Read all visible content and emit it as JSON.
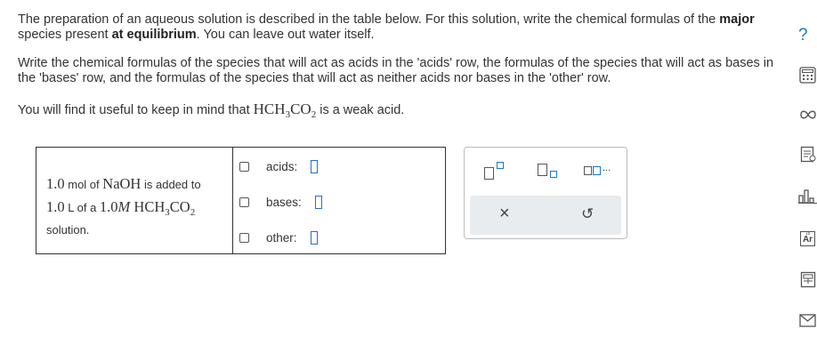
{
  "intro": {
    "p1_a": "The preparation of an aqueous solution is described in the table below. For this solution, write the chemical formulas of the",
    "p1_major": "major",
    "p1_b": "species present",
    "p1_eq": "at equilibrium",
    "p1_c": ". You can leave out water itself.",
    "p2": "Write the chemical formulas of the species that will act as acids in the 'acids' row, the formulas of the species that will act as bases in the 'bases' row, and the formulas of the species that will act as neither acids nor bases in the 'other' row.",
    "p3_a": "You will find it useful to keep in mind that",
    "p3_formula_main": "HCH",
    "p3_sub1": "3",
    "p3_formula_co": "CO",
    "p3_sub2": "2",
    "p3_b": "is a weak acid."
  },
  "table": {
    "line1_amt": "1.0",
    "line1_unit": "mol of",
    "line1_species": "NaOH",
    "line1_rest": "is added to",
    "line2_amt": "1.0",
    "line2_unit": "L of a",
    "line2_conc": "1.0",
    "line2_M": "M",
    "line2_formula": "HCH",
    "line2_sub1": "3",
    "line2_co": "CO",
    "line2_sub2": "2",
    "line3": "solution.",
    "rows": [
      {
        "label": "acids:"
      },
      {
        "label": "bases:"
      },
      {
        "label": "other:"
      }
    ]
  },
  "toolbox": {
    "ellipsis": "...",
    "clear_symbol": "×",
    "undo_symbol": "↺"
  },
  "sidebar": {
    "help": "?",
    "periodic_label": "Ar",
    "periodic_number": "18"
  },
  "colors": {
    "accent": "#1a78c2",
    "answer_box": "#1f6fd1",
    "toolbox_bottom": "#e8ecef"
  }
}
